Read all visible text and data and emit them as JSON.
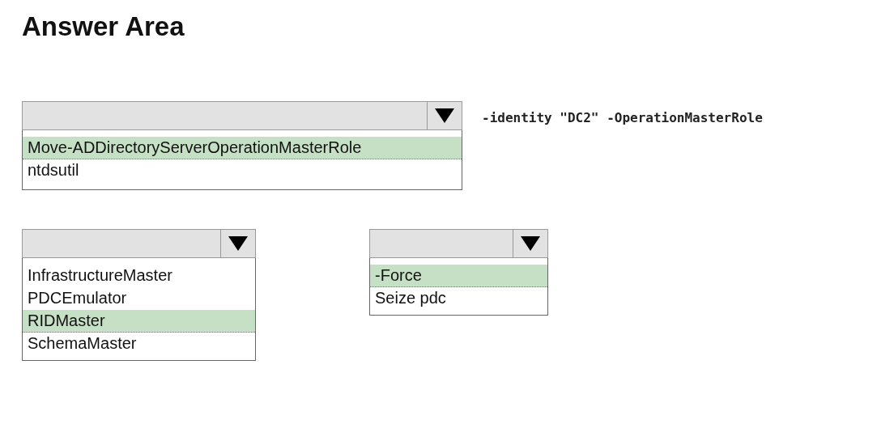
{
  "title": "Answer Area",
  "row_1": {
    "dropdown": {
      "options": [
        {
          "label": "Move-ADDirectoryServerOperationMasterRole",
          "selected": true
        },
        {
          "label": "ntdsutil",
          "selected": false
        }
      ]
    },
    "command_text": "-identity \"DC2\" -OperationMasterRole"
  },
  "row_2": [
    {
      "options": [
        {
          "label": "InfrastructureMaster",
          "selected": false
        },
        {
          "label": "PDCEmulator",
          "selected": false
        },
        {
          "label": "RIDMaster",
          "selected": true
        },
        {
          "label": "SchemaMaster",
          "selected": false
        }
      ]
    },
    {
      "options": [
        {
          "label": "-Force",
          "selected": true
        },
        {
          "label": "Seize pdc",
          "selected": false
        }
      ]
    }
  ]
}
